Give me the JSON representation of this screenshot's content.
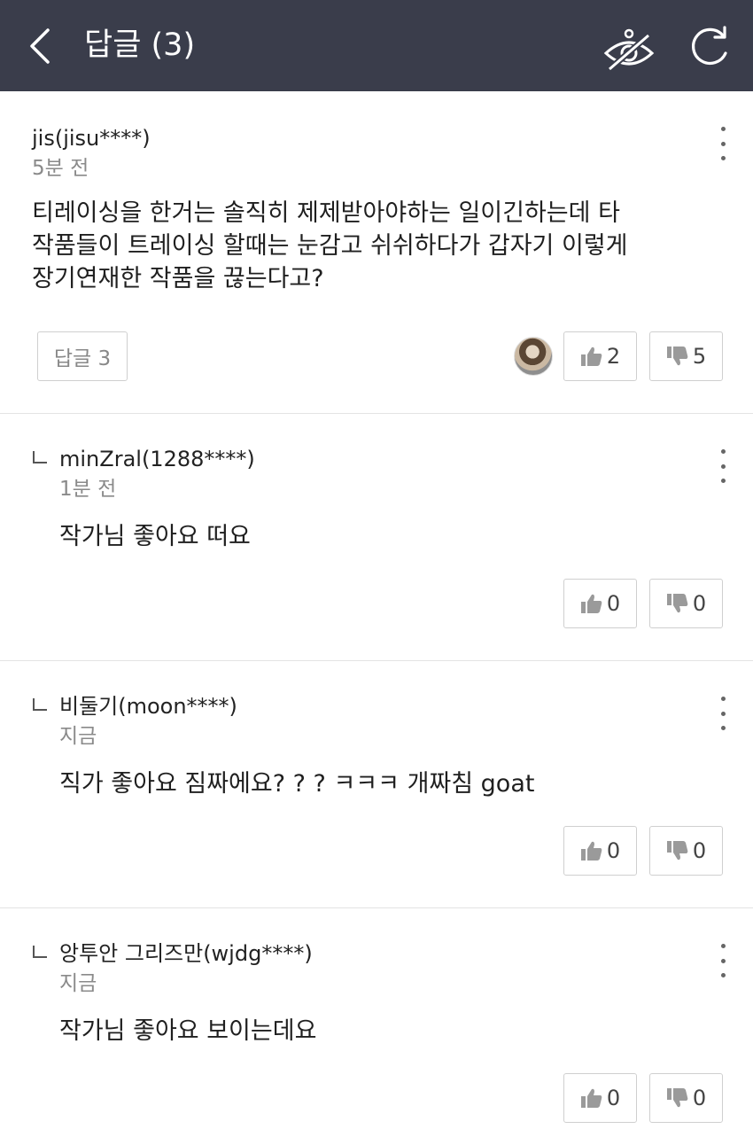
{
  "header": {
    "title": "답글 (3)",
    "back_icon": "chevron-left-icon",
    "hide_icon": "eye-off-icon",
    "refresh_icon": "refresh-icon",
    "background": "#3a3d4b"
  },
  "main_comment": {
    "author": "jis(jisu****)",
    "time": "5분 전",
    "text_lines": [
      "티레이싱을 한거는 솔직히 제제받아야하는 일이긴하는데  타",
      "작품들이 트레이싱 할때는 눈감고 쉬쉬하다가 갑자기 이렇게",
      "장기연재한 작품을 끊는다고?"
    ],
    "reply_button": "답글 3",
    "likes": "2",
    "dislikes": "5"
  },
  "replies": [
    {
      "author": "minZral(1288****)",
      "time": "1분 전",
      "text": "작가님 좋아요 떠요",
      "likes": "0",
      "dislikes": "0"
    },
    {
      "author": "비둘기(moon****)",
      "time": "지금",
      "text": "직가 좋아요 짐짜에요? ? ?  ㅋㅋㅋ 개짜침 goat",
      "likes": "0",
      "dislikes": "0"
    },
    {
      "author": "앙투안 그리즈만(wjdg****)",
      "time": "지금",
      "text": "작가님 좋아요 보이는데요",
      "likes": "0",
      "dislikes": "0"
    }
  ]
}
